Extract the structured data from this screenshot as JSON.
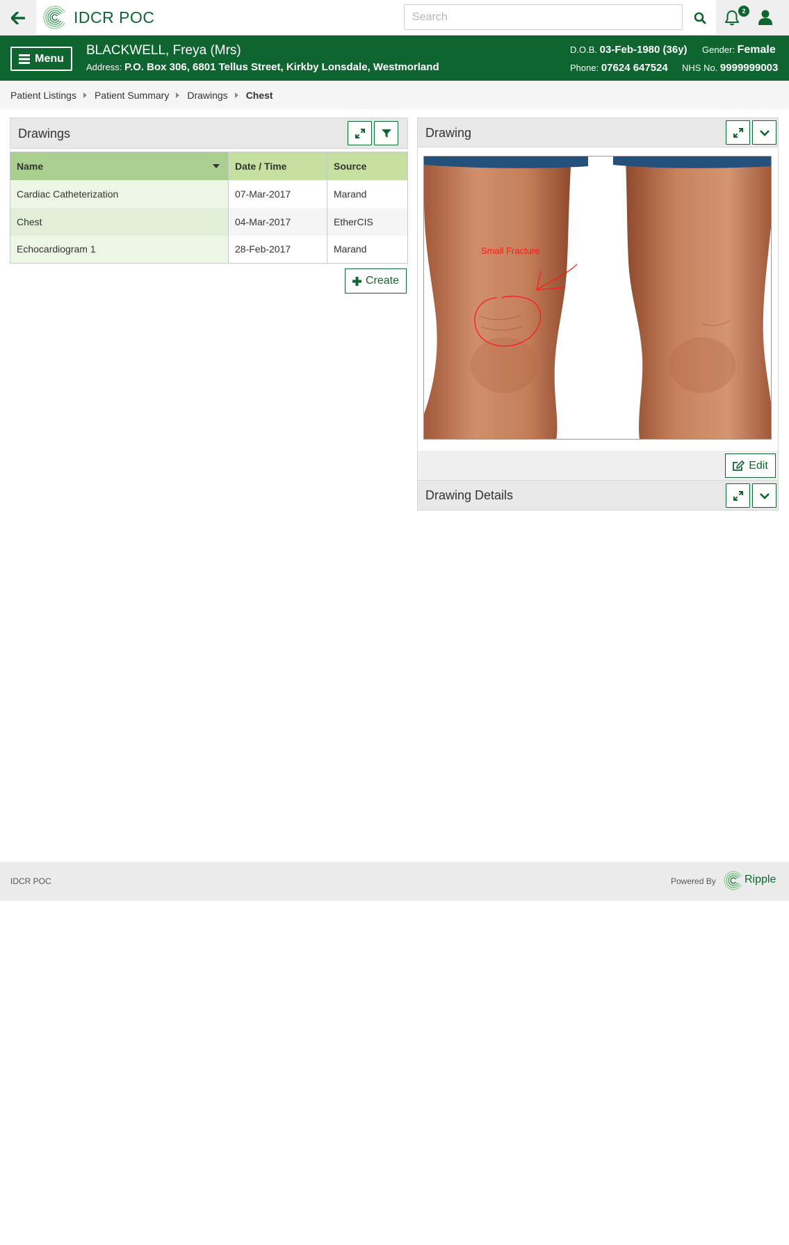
{
  "app": {
    "title": "IDCR POC"
  },
  "search": {
    "placeholder": "Search",
    "value": ""
  },
  "notifications": {
    "count": "2"
  },
  "menu": {
    "label": "Menu"
  },
  "patient": {
    "name": "BLACKWELL, Freya (Mrs)",
    "address_label": "Address:",
    "address": "P.O. Box 306, 6801 Tellus Street, Kirkby Lonsdale, Westmorland",
    "dob_label": "D.O.B.",
    "dob": "03-Feb-1980 (36y)",
    "gender_label": "Gender:",
    "gender": "Female",
    "phone_label": "Phone:",
    "phone": "07624 647524",
    "nhs_label": "NHS No.",
    "nhs": "9999999003"
  },
  "breadcrumb": {
    "items": [
      "Patient Listings",
      "Patient Summary",
      "Drawings"
    ],
    "current": "Chest"
  },
  "drawings_panel": {
    "title": "Drawings",
    "columns": [
      "Name",
      "Date / Time",
      "Source"
    ],
    "rows": [
      {
        "name": "Cardiac Catheterization",
        "date": "07-Mar-2017",
        "source": "Marand"
      },
      {
        "name": "Chest",
        "date": "04-Mar-2017",
        "source": "EtherCIS"
      },
      {
        "name": "Echocardiogram  1",
        "date": "28-Feb-2017",
        "source": "Marand"
      }
    ],
    "create_label": "Create"
  },
  "drawing_panel": {
    "title": "Drawing",
    "annotation": "Small Fracture",
    "edit_label": "Edit"
  },
  "details_panel": {
    "title": "Drawing Details"
  },
  "footer": {
    "left": "IDCR POC",
    "powered_by": "Powered By",
    "brand": "Ripple"
  },
  "colors": {
    "brand_green": "#0e6530",
    "header_green": "#a9d08e",
    "annotation_red": "#ff1a1a"
  }
}
